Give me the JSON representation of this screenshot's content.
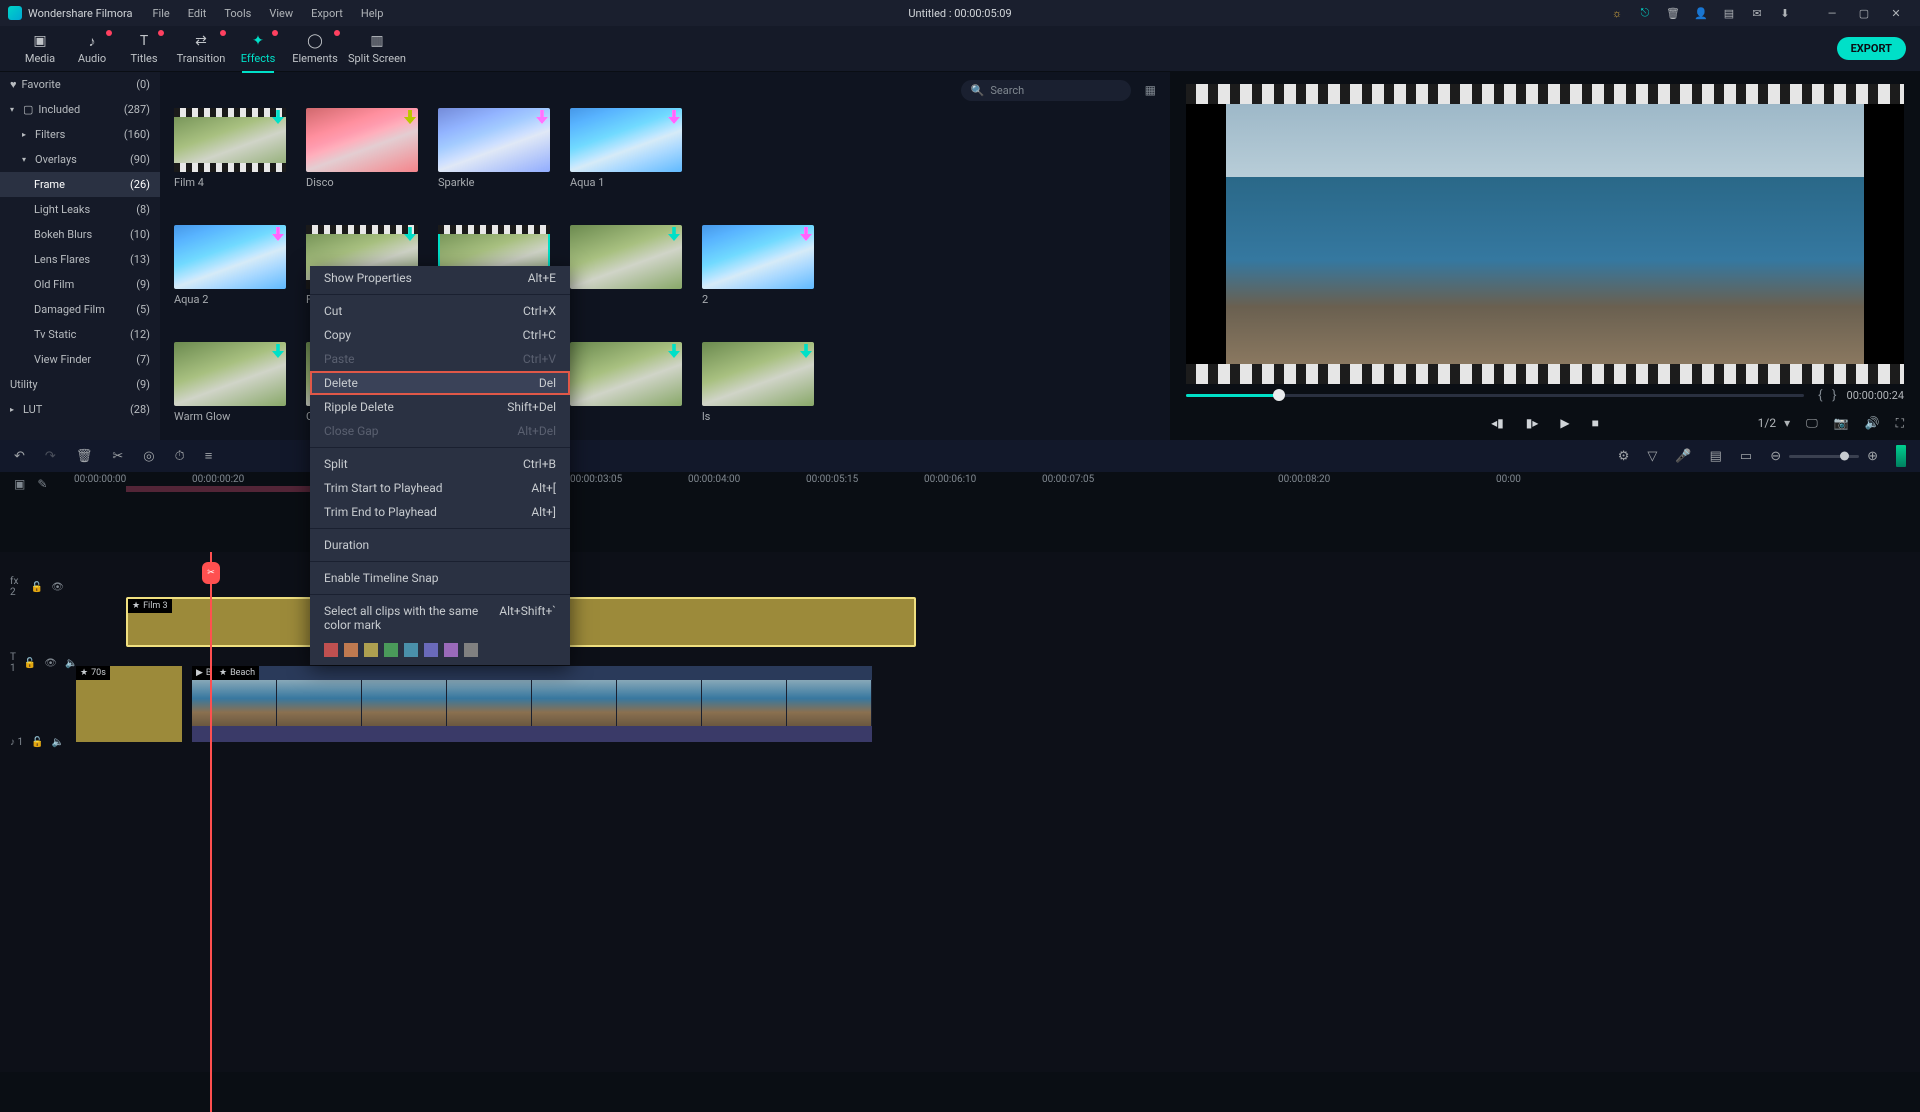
{
  "titlebar": {
    "app": "Wondershare Filmora",
    "menu": [
      "File",
      "Edit",
      "Tools",
      "View",
      "Export",
      "Help"
    ],
    "project": "Untitled : 00:00:05:09"
  },
  "tooltabs": {
    "media": "Media",
    "audio": "Audio",
    "titles": "Titles",
    "transition": "Transition",
    "effects": "Effects",
    "elements": "Elements",
    "split": "Split Screen",
    "export": "EXPORT"
  },
  "search": {
    "placeholder": "Search"
  },
  "sidebar": {
    "favorite": {
      "label": "Favorite",
      "count": "(0)"
    },
    "included": {
      "label": "Included",
      "count": "(287)"
    },
    "filters": {
      "label": "Filters",
      "count": "(160)"
    },
    "overlays": {
      "label": "Overlays",
      "count": "(90)"
    },
    "items": [
      {
        "label": "Frame",
        "count": "(26)"
      },
      {
        "label": "Light Leaks",
        "count": "(8)"
      },
      {
        "label": "Bokeh Blurs",
        "count": "(10)"
      },
      {
        "label": "Lens Flares",
        "count": "(13)"
      },
      {
        "label": "Old Film",
        "count": "(9)"
      },
      {
        "label": "Damaged Film",
        "count": "(5)"
      },
      {
        "label": "Tv Static",
        "count": "(12)"
      },
      {
        "label": "View Finder",
        "count": "(7)"
      }
    ],
    "utility": {
      "label": "Utility",
      "count": "(9)"
    },
    "lut": {
      "label": "LUT",
      "count": "(28)"
    }
  },
  "effects": {
    "row1": [
      {
        "name": "Film 4",
        "v": "film"
      },
      {
        "name": "Disco",
        "v": "disco"
      },
      {
        "name": "Sparkle",
        "v": "sparkle"
      },
      {
        "name": "Aqua 1",
        "v": "aqua"
      }
    ],
    "row2": [
      {
        "name": "Aqua 2",
        "v": "aqua"
      },
      {
        "name": "Film",
        "v": "film"
      },
      {
        "name": "",
        "v": "selected"
      },
      {
        "name": "",
        "v": ""
      },
      {
        "name": "2",
        "v": "aqua"
      }
    ],
    "row3": [
      {
        "name": "Warm Glow",
        "v": ""
      },
      {
        "name": "Co",
        "v": ""
      },
      {
        "name": "",
        "v": ""
      },
      {
        "name": "",
        "v": ""
      },
      {
        "name": "ls",
        "v": ""
      }
    ],
    "row4": [
      {
        "name": "",
        "v": ""
      },
      {
        "name": "",
        "v": ""
      },
      {
        "name": "",
        "v": ""
      },
      {
        "name": "",
        "v": ""
      },
      {
        "name": "",
        "v": ""
      }
    ]
  },
  "preview": {
    "endtime": "00:00:00:24",
    "ratio": "1/2"
  },
  "ruler": {
    "labels": [
      "00:00:00:00",
      "00:00:00:20",
      "00:00:03:05",
      "00:00:04:00",
      "00:00:05:15",
      "00:00:06:10",
      "00:00:07:05",
      "00:00:08:20",
      "00:00"
    ]
  },
  "tracks": {
    "fx": {
      "head": "fx 2",
      "clip": "Film 3"
    },
    "video": {
      "head": "T 1",
      "short": "70s",
      "beach_prefix": "B",
      "beach": "Beach"
    },
    "audio": {
      "head": "♪ 1"
    }
  },
  "ctx": {
    "show_properties": {
      "l": "Show Properties",
      "s": "Alt+E"
    },
    "cut": {
      "l": "Cut",
      "s": "Ctrl+X"
    },
    "copy": {
      "l": "Copy",
      "s": "Ctrl+C"
    },
    "paste": {
      "l": "Paste",
      "s": "Ctrl+V"
    },
    "delete": {
      "l": "Delete",
      "s": "Del"
    },
    "ripple": {
      "l": "Ripple Delete",
      "s": "Shift+Del"
    },
    "closegap": {
      "l": "Close Gap",
      "s": "Alt+Del"
    },
    "split": {
      "l": "Split",
      "s": "Ctrl+B"
    },
    "trim_start": {
      "l": "Trim Start to Playhead",
      "s": "Alt+["
    },
    "trim_end": {
      "l": "Trim End to Playhead",
      "s": "Alt+]"
    },
    "duration": {
      "l": "Duration"
    },
    "snap": {
      "l": "Enable Timeline Snap"
    },
    "select_color": {
      "l": "Select all clips with the same color mark",
      "s": "Alt+Shift+`"
    },
    "colors": [
      "#c05050",
      "#c07a50",
      "#aea050",
      "#4a9a5a",
      "#4a90aa",
      "#6a6aba",
      "#9a6aba",
      "#808080"
    ]
  }
}
